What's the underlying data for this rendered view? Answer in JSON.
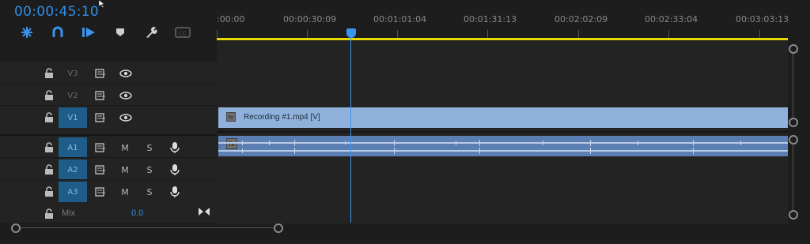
{
  "header": {
    "timecode": "00:00:45:10",
    "tools": [
      {
        "name": "snap-icon",
        "symbol": "✱"
      },
      {
        "name": "linked-selection-icon",
        "symbol": "∩"
      },
      {
        "name": "insert-edit-icon",
        "symbol": "▶"
      },
      {
        "name": "marker-icon",
        "symbol": "⬟"
      },
      {
        "name": "wrench-icon",
        "symbol": "🔧"
      },
      {
        "name": "captions-icon",
        "symbol": "CC"
      }
    ]
  },
  "ruler": {
    "ticks": [
      ":00:00",
      "00:00:30:09",
      "00:01:01:04",
      "00:01:31:13",
      "00:02:02:09",
      "00:02:33:04",
      "00:03:03:13"
    ]
  },
  "tracks": {
    "video": [
      {
        "name": "V3",
        "active": false
      },
      {
        "name": "V2",
        "active": false
      },
      {
        "name": "V1",
        "active": true
      }
    ],
    "audio": [
      {
        "name": "A1",
        "active": true
      },
      {
        "name": "A2",
        "active": true
      },
      {
        "name": "A3",
        "active": true
      }
    ],
    "mute_label": "M",
    "solo_label": "S",
    "mix": {
      "label": "Mix",
      "value": "0.0"
    }
  },
  "clips": {
    "video_clip_label": "Recording #1.mp4 [V]"
  },
  "colors": {
    "accent": "#2f8fe8",
    "workarea": "#e7d800",
    "video_clip": "#8fb1db",
    "audio_clip": "#5b7fb2"
  }
}
